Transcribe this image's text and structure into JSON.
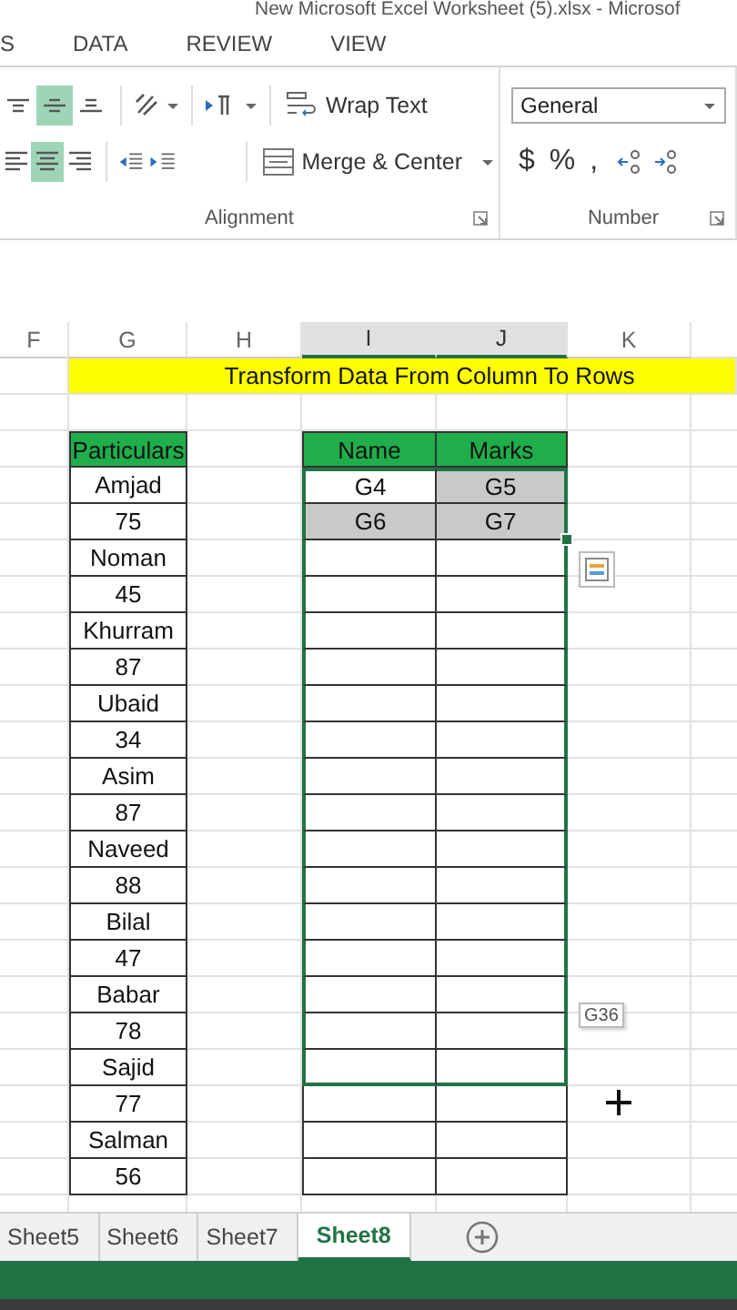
{
  "window": {
    "title": "New Microsoft Excel Worksheet (5).xlsx - Microsof"
  },
  "ribbon_tabs": [
    {
      "label": "S",
      "selected": false
    },
    {
      "label": "DATA",
      "selected": false
    },
    {
      "label": "REVIEW",
      "selected": false
    },
    {
      "label": "VIEW",
      "selected": false
    }
  ],
  "alignment": {
    "label": "Alignment",
    "top_row": [
      {
        "kind": "top",
        "selected": false
      },
      {
        "kind": "middle",
        "selected": true
      },
      {
        "kind": "bottom",
        "selected": false
      }
    ],
    "bottom_row": [
      {
        "kind": "left",
        "selected": false
      },
      {
        "kind": "center",
        "selected": true
      },
      {
        "kind": "right",
        "selected": false
      }
    ],
    "wrap_text": "Wrap Text",
    "merge_center": "Merge & Center"
  },
  "number": {
    "label": "Number",
    "format": "General",
    "symbols": [
      "$",
      "%",
      ","
    ]
  },
  "columns": [
    {
      "label": "F",
      "selected": false
    },
    {
      "label": "G",
      "selected": false
    },
    {
      "label": "H",
      "selected": false
    },
    {
      "label": "I",
      "selected": true
    },
    {
      "label": "J",
      "selected": true
    },
    {
      "label": "K",
      "selected": false
    }
  ],
  "banner": "Transform Data  From Column To Rows",
  "particulars": [
    "Particulars",
    "Amjad",
    "75",
    "Noman",
    "45",
    "Khurram",
    "87",
    "Ubaid",
    "34",
    "Asim",
    "87",
    "Naveed",
    "88",
    "Bilal",
    "47",
    "Babar",
    "78",
    "Sajid",
    "77",
    "Salman",
    "56"
  ],
  "result_table": {
    "header": [
      "Name",
      "Marks"
    ],
    "rows": [
      {
        "in_range": true,
        "cells": [
          {
            "text": "G4",
            "selected": false
          },
          {
            "text": "G5",
            "selected": true
          }
        ]
      },
      {
        "in_range": true,
        "cells": [
          {
            "text": "G6",
            "selected": true
          },
          {
            "text": "G7",
            "selected": true
          }
        ]
      },
      {
        "in_range": true
      },
      {
        "in_range": true
      },
      {
        "in_range": true
      },
      {
        "in_range": true
      },
      {
        "in_range": true
      },
      {
        "in_range": true
      },
      {
        "in_range": true
      },
      {
        "in_range": true
      },
      {
        "in_range": true
      },
      {
        "in_range": true
      },
      {
        "in_range": true
      },
      {
        "in_range": true
      },
      {
        "in_range": true
      },
      {
        "in_range": true
      },
      {
        "in_range": true
      },
      {
        "in_range": false
      },
      {
        "in_range": false
      },
      {
        "in_range": false
      }
    ]
  },
  "fill_tooltip": "G36",
  "sheet_tabs": [
    {
      "label": "Sheet5",
      "selected": false
    },
    {
      "label": "Sheet6",
      "selected": false
    },
    {
      "label": "Sheet7",
      "selected": false
    },
    {
      "label": "Sheet8",
      "selected": true
    }
  ]
}
